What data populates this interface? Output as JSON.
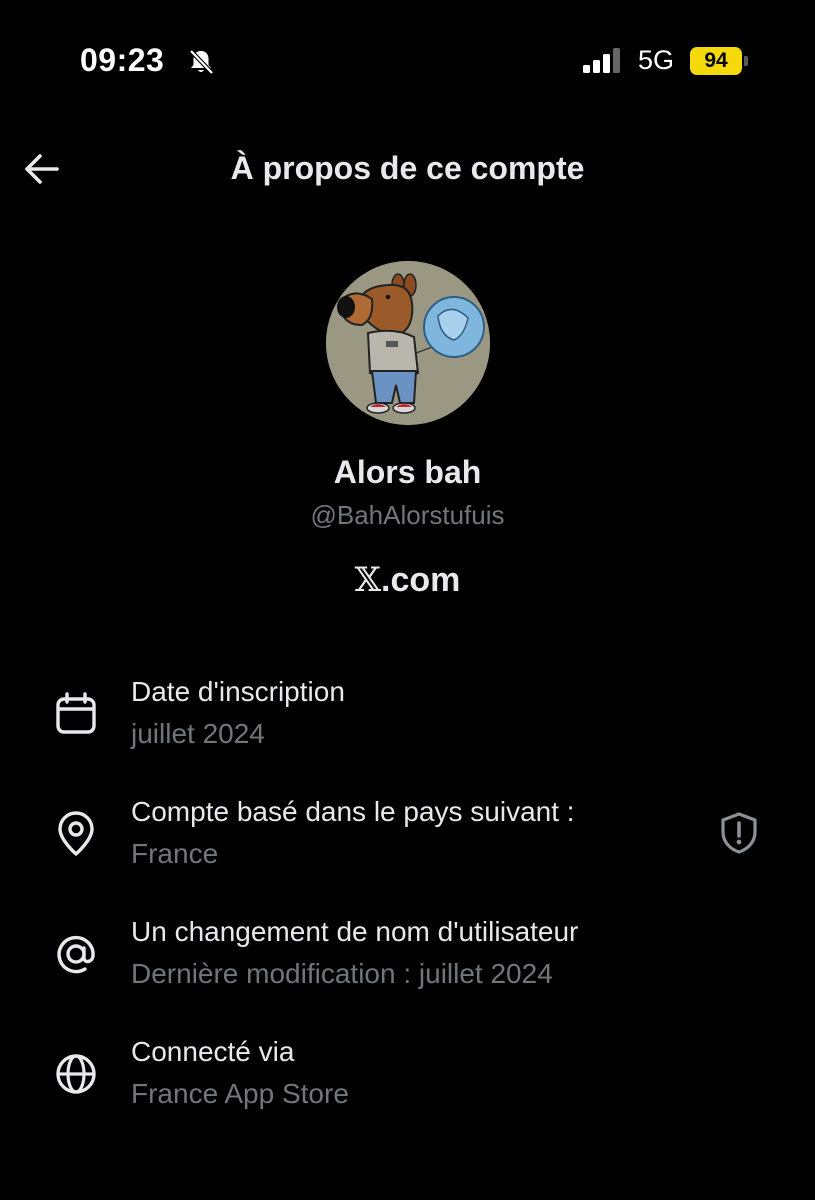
{
  "status_bar": {
    "time": "09:23",
    "network": "5G",
    "battery": "94",
    "icons": [
      "bell-slash-icon",
      "signal-icon",
      "battery-icon"
    ],
    "battery_color": "#f5d90a"
  },
  "header": {
    "title": "À propos de ce compte",
    "back_icon": "arrow-left-icon"
  },
  "profile": {
    "display_name": "Alors bah",
    "handle": "@BahAlorstufuis",
    "brand_text": ".com",
    "brand_logo": "𝕏"
  },
  "info": [
    {
      "icon": "calendar-icon",
      "label": "Date d'inscription",
      "value": "juillet 2024"
    },
    {
      "icon": "location-pin-icon",
      "label": "Compte basé dans le pays suivant :",
      "value": "France"
    },
    {
      "icon": "at-sign-icon",
      "label": "Un changement de nom d'utilisateur",
      "value": "Dernière modification : juillet 2024"
    },
    {
      "icon": "globe-icon",
      "label": "Connecté via",
      "value": "France App Store"
    }
  ],
  "colors": {
    "background": "#000000",
    "primary_text": "#e7e9ea",
    "secondary_text": "#71767b"
  }
}
